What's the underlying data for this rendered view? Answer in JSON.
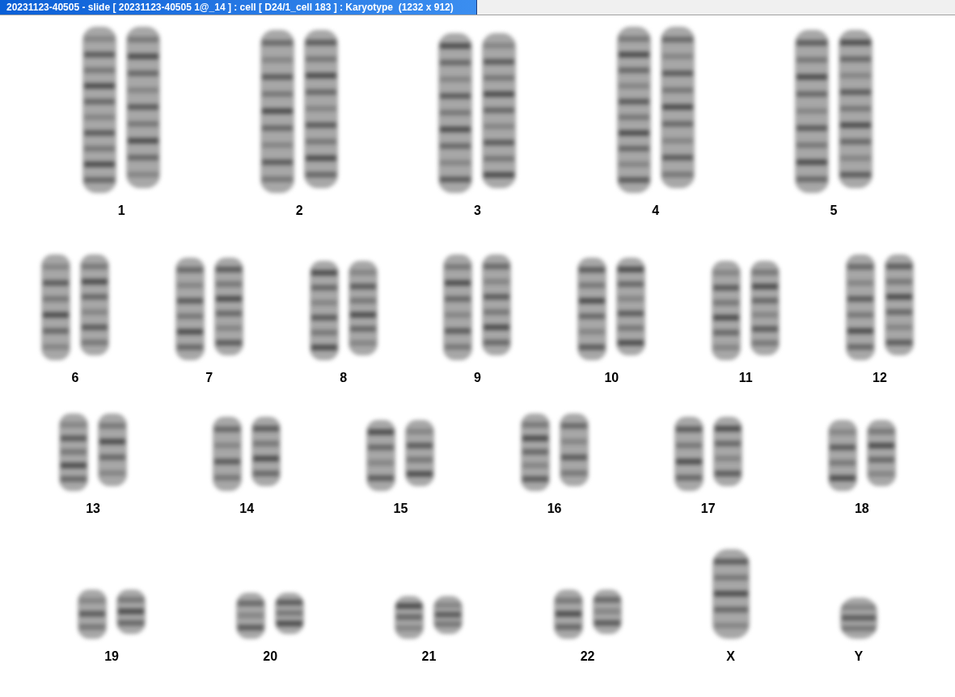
{
  "window": {
    "title": "20231123-40505 - slide [ 20231123-40505 1@_14 ] : cell [ D24/1_cell 183 ] : Karyotype  (1232 x 912)"
  },
  "rows": [
    {
      "groups": [
        {
          "label": "1",
          "kind": "pair"
        },
        {
          "label": "2",
          "kind": "pair"
        },
        {
          "label": "3",
          "kind": "pair"
        },
        {
          "label": "4",
          "kind": "pair"
        },
        {
          "label": "5",
          "kind": "pair"
        }
      ]
    },
    {
      "groups": [
        {
          "label": "6",
          "kind": "pair"
        },
        {
          "label": "7",
          "kind": "pair"
        },
        {
          "label": "8",
          "kind": "pair"
        },
        {
          "label": "9",
          "kind": "pair"
        },
        {
          "label": "10",
          "kind": "pair"
        },
        {
          "label": "11",
          "kind": "pair"
        },
        {
          "label": "12",
          "kind": "pair"
        }
      ]
    },
    {
      "groups": [
        {
          "label": "13",
          "kind": "pair"
        },
        {
          "label": "14",
          "kind": "pair"
        },
        {
          "label": "15",
          "kind": "pair"
        },
        {
          "label": "16",
          "kind": "pair"
        },
        {
          "label": "17",
          "kind": "pair"
        },
        {
          "label": "18",
          "kind": "pair"
        }
      ]
    },
    {
      "groups": [
        {
          "label": "19",
          "kind": "pair"
        },
        {
          "label": "20",
          "kind": "pair"
        },
        {
          "label": "21",
          "kind": "pair"
        },
        {
          "label": "22",
          "kind": "pair"
        },
        {
          "label": "X",
          "kind": "single"
        },
        {
          "label": "Y",
          "kind": "single"
        }
      ]
    }
  ]
}
